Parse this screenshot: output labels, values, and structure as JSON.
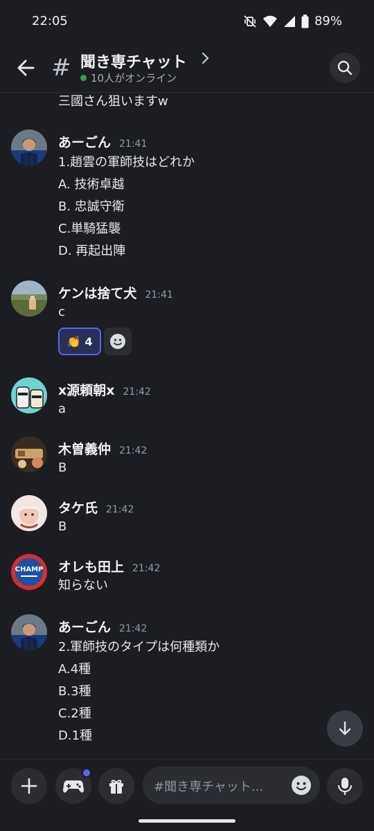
{
  "status_bar": {
    "time": "22:05",
    "battery": "89%"
  },
  "header": {
    "title": "聞き専チャット",
    "online": "10人がオンライン"
  },
  "messages": {
    "prev_text": "三國さん狙いますw",
    "m1": {
      "author": "あーごん",
      "time": "21:41",
      "lines": [
        "1.趙雲の軍師技はどれか",
        "A. 技術卓越",
        "B. 忠誠守衛",
        "C.単騎猛襲",
        "D. 再起出陣"
      ]
    },
    "m2": {
      "author": "ケンは捨て犬",
      "time": "21:41",
      "text": "c",
      "reaction": {
        "emoji": "👏",
        "count": "4"
      }
    },
    "m3": {
      "author": "x源頼朝x",
      "time": "21:42",
      "text": "a"
    },
    "m4": {
      "author": "木曽義仲",
      "time": "21:42",
      "text": "B"
    },
    "m5": {
      "author": "タケ氏",
      "time": "21:42",
      "text": "B"
    },
    "m6": {
      "author": "オレも田上",
      "time": "21:42",
      "text": "知らない",
      "avatar_text": "CHAMP"
    },
    "m7": {
      "author": "あーごん",
      "time": "21:42",
      "lines": [
        "2.軍師技のタイプは何種類か",
        "A.4種",
        "B.3種",
        "C.2種",
        "D.1種"
      ]
    }
  },
  "composer": {
    "placeholder": "#聞き専チャット..."
  },
  "colors": {
    "background": "#1c1d22",
    "accent": "#5865f2",
    "online": "#23a55a"
  }
}
